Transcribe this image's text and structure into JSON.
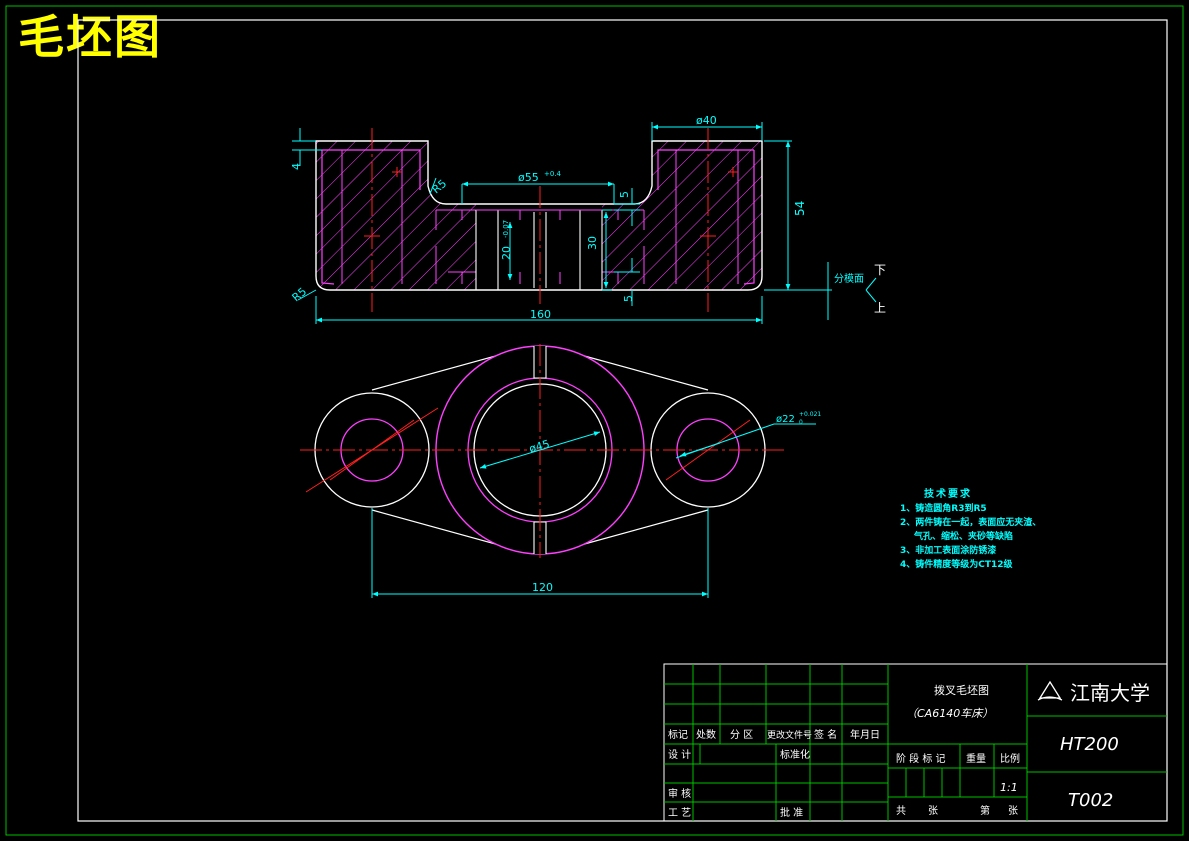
{
  "drawing_title": "毛坯图",
  "dimensions": {
    "d4": "4",
    "r5_top": "R5",
    "phi55": "ø55",
    "phi55_tol": "+0.4",
    "phi40": "ø40",
    "d5_top": "5",
    "d54": "54",
    "d20": "20",
    "d20_tol": "-0.07",
    "d30": "30",
    "d5_bottom": "5",
    "r5_bottom": "R5",
    "d160": "160",
    "phi45": "ø45",
    "phi22": "ø22",
    "phi22_tol_upper": "+0.021",
    "phi22_tol_lower": "0",
    "d120": "120"
  },
  "parting": {
    "label": "分模面",
    "upper": "下",
    "lower": "上"
  },
  "tech_requirements": {
    "heading": "技术要求",
    "lines": [
      "1、铸造圆角R3到R5",
      "2、两件铸在一起，表面应无夹渣、",
      "气孔、缩松、夹砂等缺陷",
      "3、非加工表面涂防锈漆",
      "4、铸件精度等级为CT12级"
    ]
  },
  "title_block": {
    "part_name": "拨叉毛坯图",
    "machine": "（CA6140车床）",
    "school": "江南大学",
    "material": "HT200",
    "drawing_no": "T002",
    "scale": "1:1",
    "headers": {
      "biaoji": "标记",
      "chushu": "处数",
      "fenqu": "分 区",
      "wenjian": "更改文件号",
      "qianming": "签 名",
      "nianyueri": "年月日",
      "sheji": "设 计",
      "biaozhunhua": "标准化",
      "jieduan": "阶 段 标 记",
      "zhongliang": "重量",
      "bili": "比例",
      "shenhe": "审 核",
      "gongyi": "工 艺",
      "pizhun": "批 准",
      "gong": "共",
      "zhang1": "张",
      "di": "第",
      "zhang2": "张"
    }
  },
  "colors": {
    "background": "#000000",
    "border": "#ffffff",
    "outline": "#ffffff",
    "hatch": "#ff40ff",
    "dimension": "#00ffff",
    "centerline": "#ff2020",
    "title_block": "#00c000",
    "title_text": "#ffff00"
  }
}
